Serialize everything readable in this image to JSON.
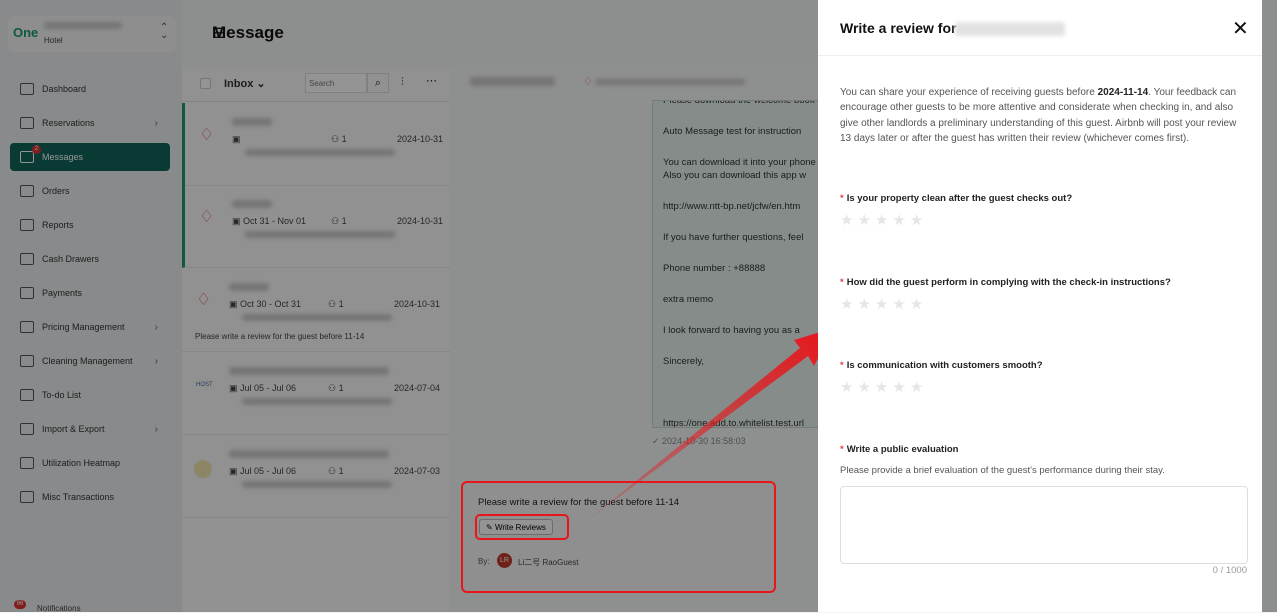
{
  "sidebar": {
    "brand_sub": "Hotel",
    "logo": "One",
    "items": [
      {
        "label": "Dashboard",
        "icon": "dashboard-icon"
      },
      {
        "label": "Reservations",
        "icon": "calendar-icon",
        "chevron": true
      },
      {
        "label": "Messages",
        "icon": "chat-icon",
        "active": true,
        "badge": "2"
      },
      {
        "label": "Orders",
        "icon": "orders-icon"
      },
      {
        "label": "Reports",
        "icon": "bar-chart-icon"
      },
      {
        "label": "Cash Drawers",
        "icon": "cash-drawer-icon"
      },
      {
        "label": "Payments",
        "icon": "card-icon"
      },
      {
        "label": "Pricing Management",
        "icon": "dollar-icon",
        "chevron": true
      },
      {
        "label": "Cleaning Management",
        "icon": "broom-icon",
        "chevron": true
      },
      {
        "label": "To-do List",
        "icon": "inbox-icon"
      },
      {
        "label": "Import & Export",
        "icon": "import-icon",
        "chevron": true
      },
      {
        "label": "Utilization Heatmap",
        "icon": "heatmap-icon"
      },
      {
        "label": "Misc Transactions",
        "icon": "dollar-icon"
      }
    ],
    "notifications": {
      "label": "Notifications",
      "badge": "96"
    }
  },
  "header": {
    "title": "Message"
  },
  "list": {
    "folder": "Inbox",
    "search_placeholder": "Search",
    "items": [
      {
        "channel": "airbnb",
        "dates": "",
        "guests": "1",
        "date": "2024-10-31",
        "preview": ""
      },
      {
        "channel": "airbnb",
        "dates": "Oct 31 - Nov 01",
        "guests": "1",
        "date": "2024-10-31",
        "preview": ""
      },
      {
        "channel": "airbnb",
        "dates": "Oct 30 - Oct 31",
        "guests": "1",
        "date": "2024-10-31",
        "preview": "Please write a review for the guest before 11-14"
      },
      {
        "channel": "host",
        "channel_label": "HOST",
        "dates": "Jul 05 - Jul 06",
        "guests": "1",
        "date": "2024-07-04",
        "preview": ""
      },
      {
        "channel": "chat",
        "dates": "Jul 05 - Jul 06",
        "guests": "1",
        "date": "2024-07-03",
        "preview": ""
      }
    ]
  },
  "chat": {
    "lines": [
      "Please download the welcome book",
      "Auto Message test for instruction",
      "You can download it into your phone\nAlso you can download this app w",
      "http://www.ntt-bp.net/jcfw/en.htm",
      "If you have further questions, feel",
      "Phone number : +88888",
      "extra memo",
      "I look forward to having you as a",
      "Sincerely,",
      "",
      "https://one.add.to.whitelist.test.url"
    ],
    "timestamp": "2024-10-30 16:58:03",
    "review_card": {
      "text": "Please write a review for the guest before 11-14",
      "button": "Write Reviews",
      "by_label": "By:",
      "avatar": "LR",
      "author": "Li二号 RaoGuest"
    }
  },
  "drawer": {
    "title": "Write a review for",
    "intro_pre": "You can share your experience of receiving guests before ",
    "intro_date": "2024-11-14",
    "intro_post": ". Your feedback can encourage other guests to be more attentive and considerate when checking in, and also give other landlords a preliminary understanding of this guest. Airbnb will post your review 13 days later or after the guest has written their review (whichever comes first).",
    "questions": [
      {
        "label": "Is your property clean after the guest checks out?",
        "rating": 0,
        "max": 5
      },
      {
        "label": "How did the guest perform in complying with the check-in instructions?",
        "rating": 0,
        "max": 5
      },
      {
        "label": "Is communication with customers smooth?",
        "rating": 0,
        "max": 5
      }
    ],
    "evaluation": {
      "label": "Write a public evaluation",
      "hint": "Please provide a brief evaluation of the guest's performance during their stay.",
      "value": "",
      "counter": "0 / 1000"
    }
  },
  "colors": {
    "accent": "#11675a",
    "annotation": "#e8161b",
    "airbnb": "#e0565b"
  }
}
